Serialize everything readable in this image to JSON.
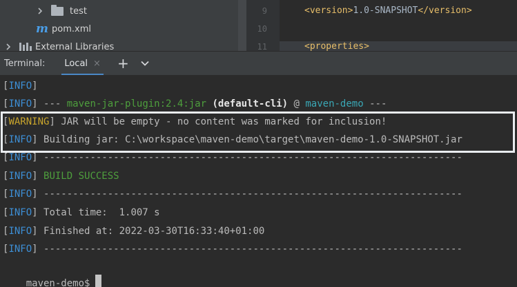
{
  "project_tree": {
    "items": [
      {
        "label": "test",
        "icon": "folder-icon"
      },
      {
        "label": "pom.xml",
        "icon": "maven-icon",
        "glyph": "m"
      },
      {
        "label": "External Libraries",
        "icon": "libraries-icon"
      }
    ]
  },
  "editor": {
    "lines": [
      {
        "number": "9",
        "tag_open": "<version>",
        "text": "1.0-SNAPSHOT",
        "tag_close": "</version>"
      },
      {
        "number": "10",
        "tag_open": "",
        "text": "",
        "tag_close": ""
      },
      {
        "number": "11",
        "tag_open": "<properties>",
        "text": "",
        "tag_close": ""
      }
    ]
  },
  "terminal_tabs": {
    "title": "Terminal:",
    "active_tab": "Local",
    "close_glyph": "×",
    "new_tab_glyph": "+",
    "more_glyph": "⌄"
  },
  "terminal": {
    "lines": [
      {
        "level": "INFO",
        "segments": []
      },
      {
        "level": "INFO",
        "segments": [
          {
            "text": " --- ",
            "style": "plain"
          },
          {
            "text": "maven-jar-plugin:2.4:jar",
            "style": "green"
          },
          {
            "text": " ",
            "style": "plain"
          },
          {
            "text": "(default-cli)",
            "style": "bold"
          },
          {
            "text": " @ ",
            "style": "plain"
          },
          {
            "text": "maven-demo",
            "style": "cyan"
          },
          {
            "text": " ---",
            "style": "plain"
          }
        ]
      },
      {
        "level": "WARNING",
        "segments": [
          {
            "text": " JAR will be empty - no content was marked for inclusion!",
            "style": "plain"
          }
        ]
      },
      {
        "level": "INFO",
        "segments": [
          {
            "text": " Building jar: C:\\workspace\\maven-demo\\target\\maven-demo-1.0-SNAPSHOT.jar",
            "style": "plain"
          }
        ]
      },
      {
        "level": "INFO",
        "segments": [
          {
            "text": " ------------------------------------------------------------------------",
            "style": "plain"
          }
        ]
      },
      {
        "level": "INFO",
        "segments": [
          {
            "text": " BUILD SUCCESS",
            "style": "green"
          }
        ]
      },
      {
        "level": "INFO",
        "segments": [
          {
            "text": " ------------------------------------------------------------------------",
            "style": "plain"
          }
        ]
      },
      {
        "level": "INFO",
        "segments": [
          {
            "text": " Total time:  1.007 s",
            "style": "plain"
          }
        ]
      },
      {
        "level": "INFO",
        "segments": [
          {
            "text": " Finished at: 2022-03-30T16:33:40+01:00",
            "style": "plain"
          }
        ]
      },
      {
        "level": "INFO",
        "segments": [
          {
            "text": " ------------------------------------------------------------------------",
            "style": "plain"
          }
        ]
      }
    ],
    "prompt": "maven-demo$"
  },
  "colors": {
    "info": "#3d8fd6",
    "warning": "#c9a52c",
    "success": "#4e9f3d",
    "project_name": "#3aa7b5"
  }
}
